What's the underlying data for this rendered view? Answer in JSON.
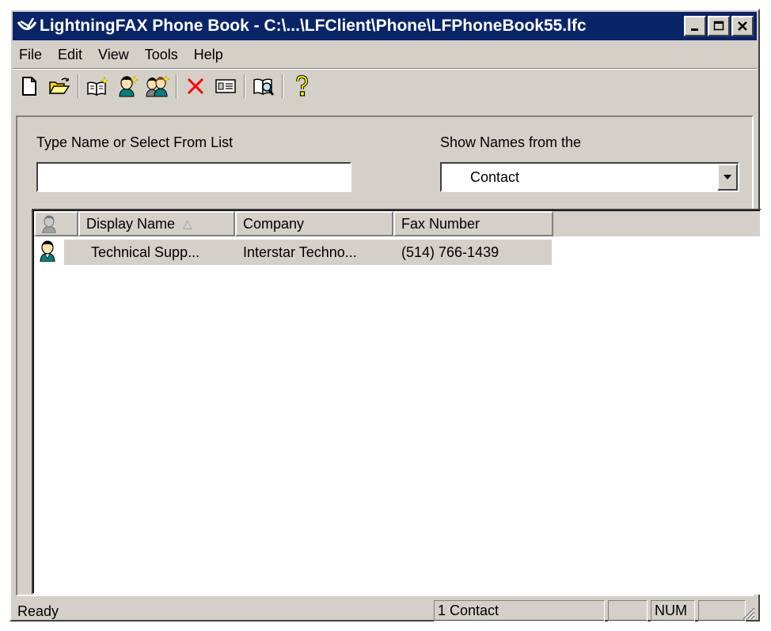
{
  "window": {
    "title": "LightningFAX Phone Book - C:\\...\\LFClient\\Phone\\LFPhoneBook55.lfc"
  },
  "menu": {
    "items": [
      "File",
      "Edit",
      "View",
      "Tools",
      "Help"
    ]
  },
  "toolbar": {
    "icons": [
      "new-icon",
      "open-folder-icon",
      "phone-book-icon",
      "new-contact-icon",
      "new-group-icon",
      "delete-icon",
      "properties-icon",
      "find-icon",
      "help-icon"
    ]
  },
  "search": {
    "label": "Type Name or Select From List",
    "value": ""
  },
  "source": {
    "label": "Show Names from the",
    "selected": "Contact"
  },
  "list": {
    "columns": [
      "",
      "Display Name",
      "Company",
      "Fax Number"
    ],
    "sort_indicator": "△",
    "rows": [
      {
        "type_icon": "contact-person-icon",
        "display_name": "Technical Supp...",
        "company": "Interstar Techno...",
        "fax": "(514) 766-1439"
      }
    ]
  },
  "status": {
    "ready": "Ready",
    "count": "1 Contact",
    "pane_empty": "",
    "num": "NUM",
    "pane_last": ""
  },
  "colors": {
    "title_bar": "#0a246a",
    "face": "#d4d0c8",
    "selection": "#d4d0c8",
    "delete_red": "#ff0000"
  }
}
